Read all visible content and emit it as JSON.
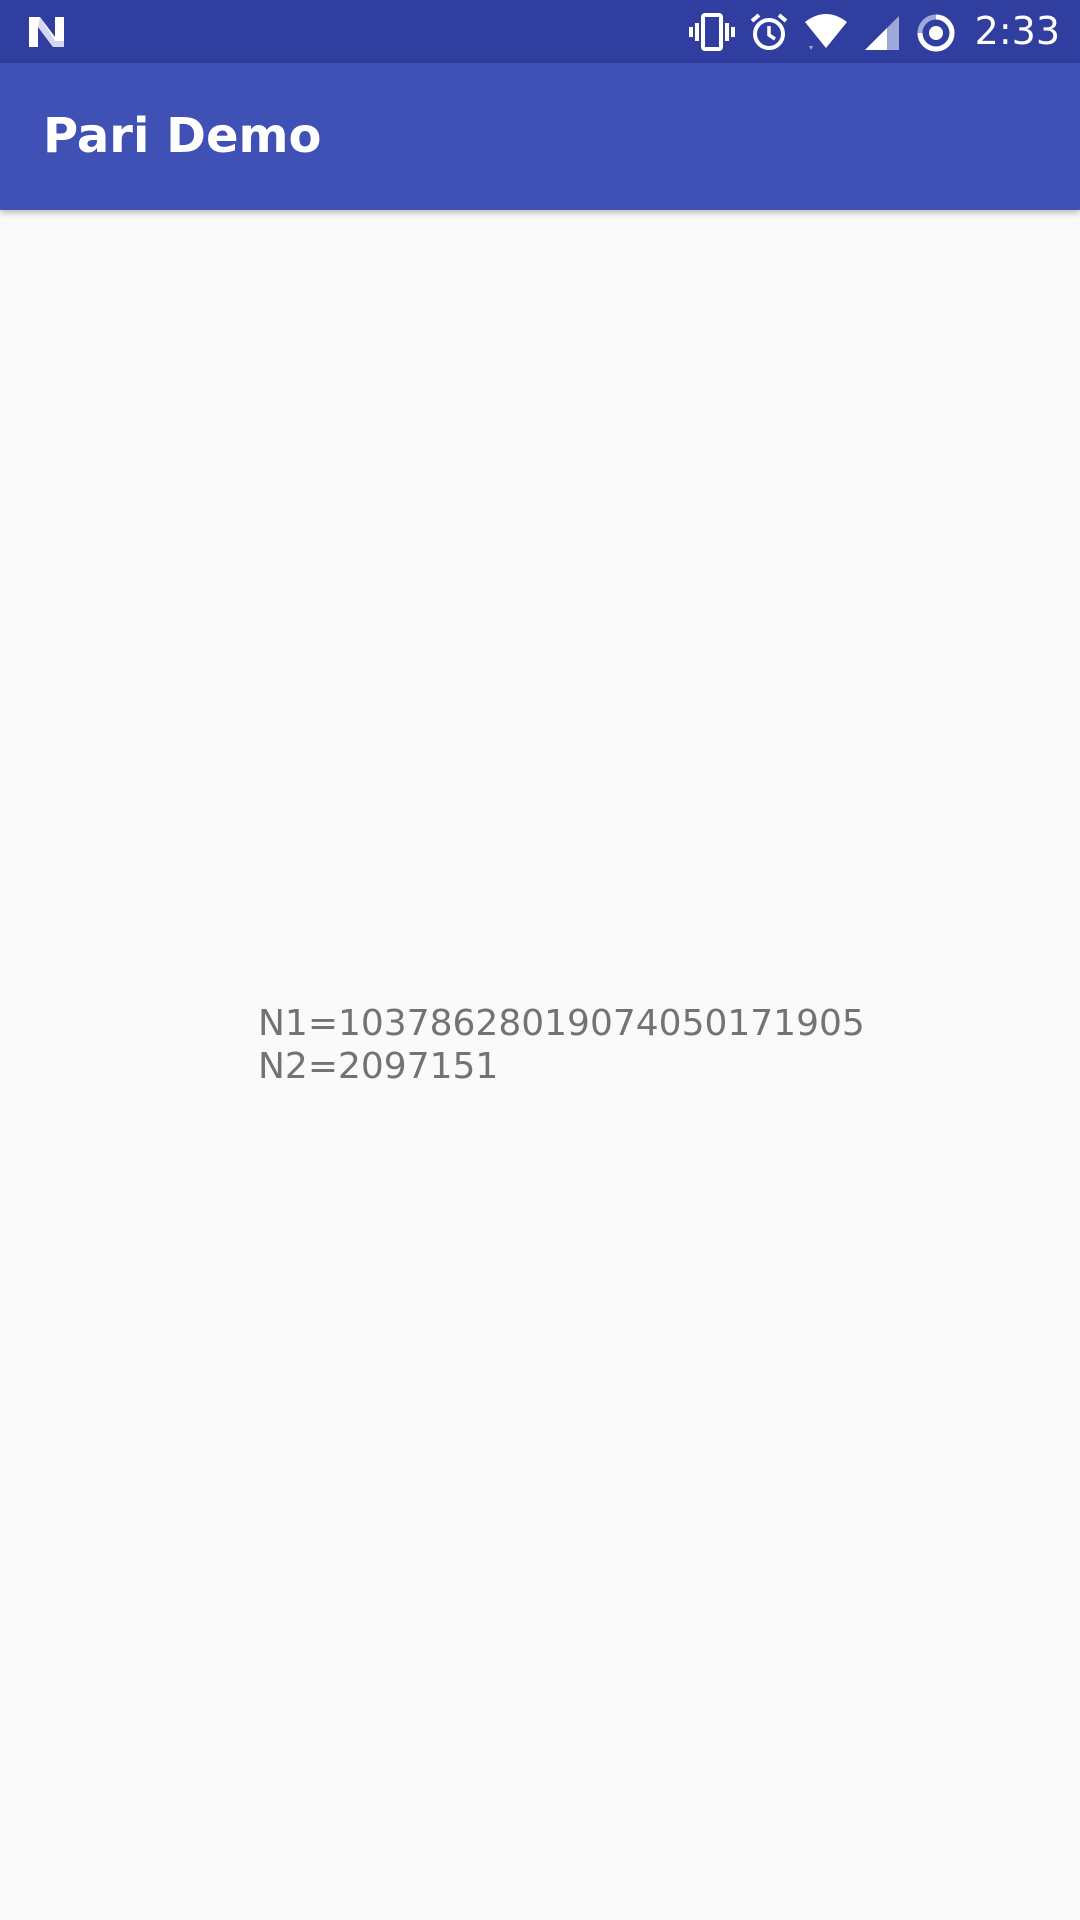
{
  "status_bar": {
    "time": "2:33",
    "icons": [
      "android-n-icon",
      "vibrate-icon",
      "alarm-icon",
      "wifi-icon",
      "cell-signal-icon",
      "sync-icon"
    ]
  },
  "app_bar": {
    "title": "Pari Demo"
  },
  "main": {
    "lines": [
      "N1=1037862801907405 0171905",
      "N2=2097151"
    ]
  }
}
